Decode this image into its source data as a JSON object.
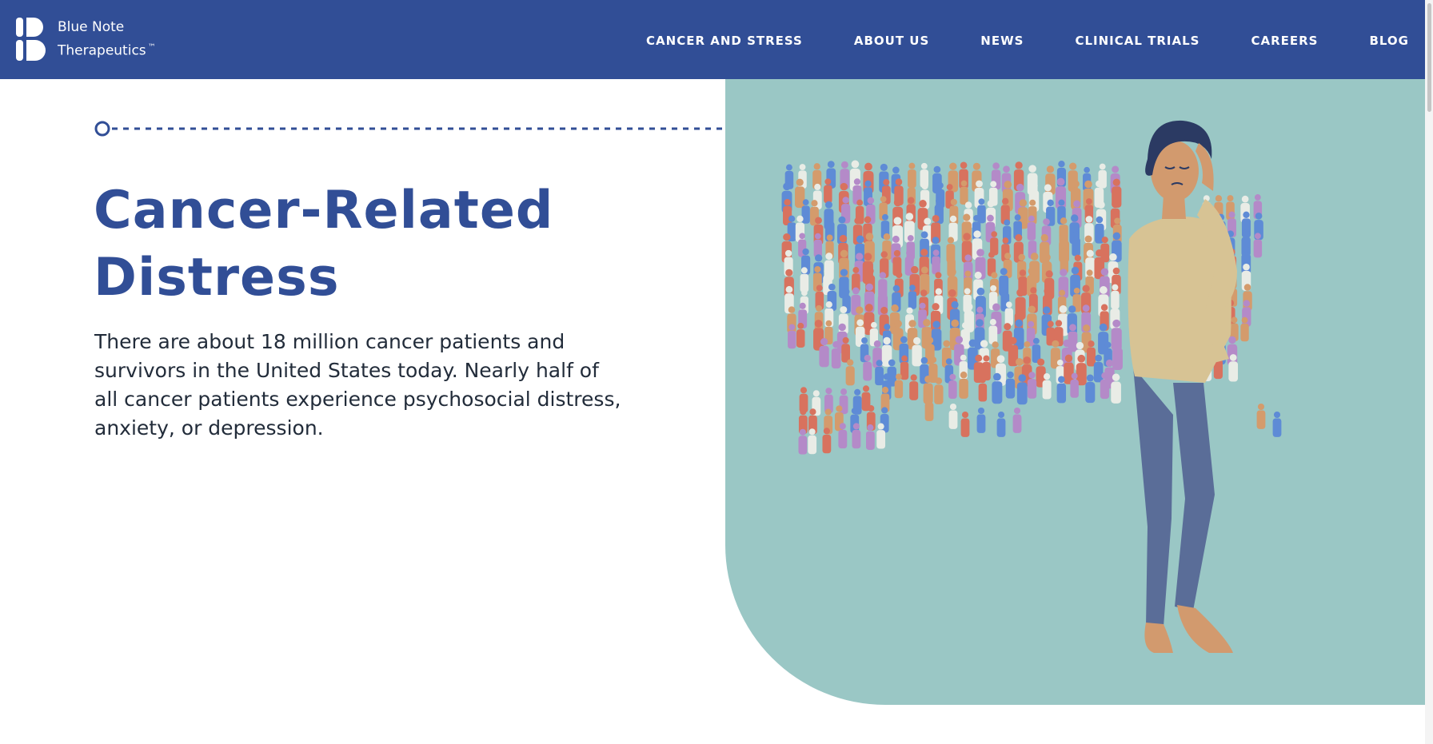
{
  "brand": {
    "name_line1": "Blue Note",
    "name_line2": "Therapeutics",
    "trademark": "™",
    "color": "#314e96"
  },
  "nav": {
    "items": [
      {
        "label": "CANCER AND STRESS"
      },
      {
        "label": "ABOUT US"
      },
      {
        "label": "NEWS"
      },
      {
        "label": "CLINICAL TRIALS"
      },
      {
        "label": "CAREERS"
      },
      {
        "label": "BLOG"
      }
    ]
  },
  "hero": {
    "title_line1": "Cancer-Related",
    "title_line2": "Distress",
    "body": "There are about 18 million cancer patients and survivors in the United States today. Nearly half of all cancer patients experience psychosocial distress, anxiety, or depression.",
    "panel_color": "#9ac7c5",
    "crowd_colors": [
      "#d8725e",
      "#5e8bd6",
      "#b48ac8",
      "#d49b6c",
      "#e9ece6"
    ]
  }
}
